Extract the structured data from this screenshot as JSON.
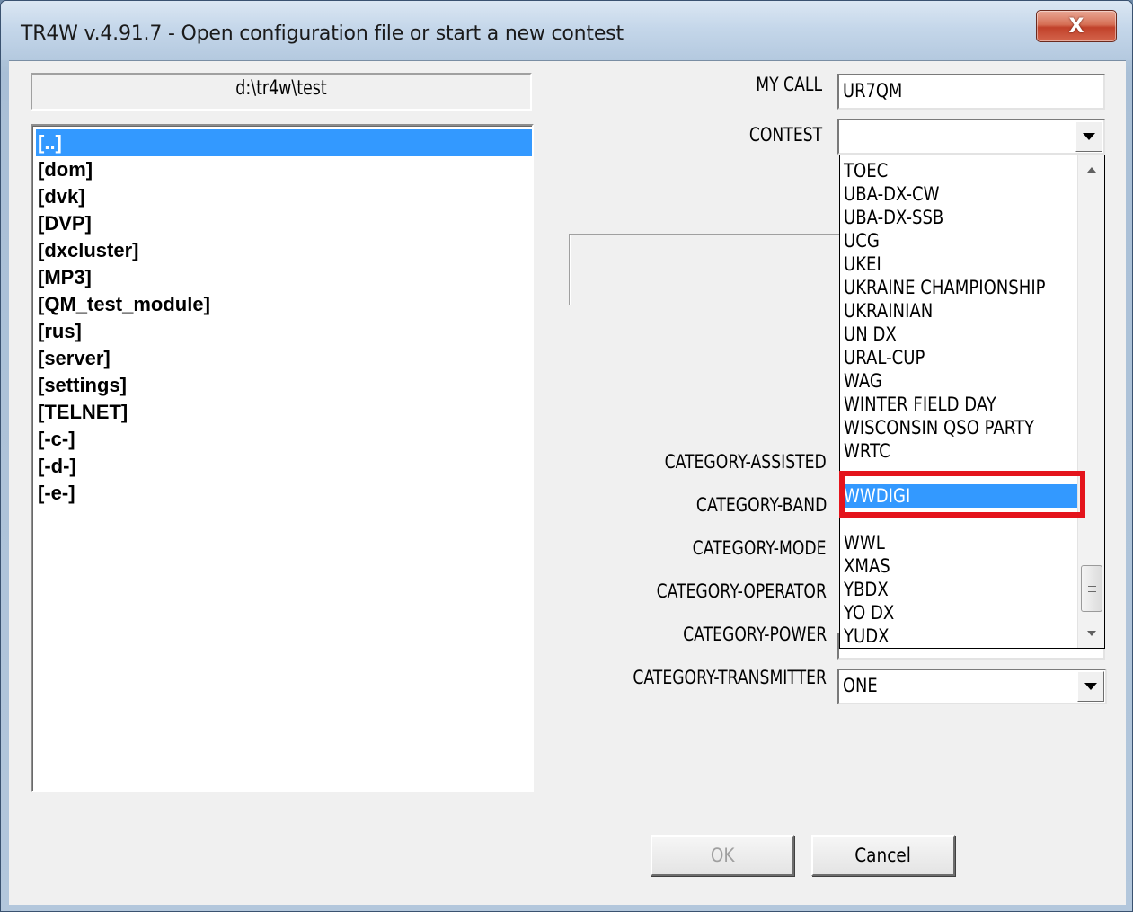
{
  "window": {
    "title": "TR4W v.4.91.7 - Open configuration file or start a new contest",
    "close_glyph": "X"
  },
  "directory": {
    "path": "d:\\tr4w\\test",
    "items": [
      "[..]",
      "[dom]",
      "[dvk]",
      "[DVP]",
      "[dxcluster]",
      "[MP3]",
      "[QM_test_module]",
      "[rus]",
      "[server]",
      "[settings]",
      "[TELNET]",
      "[-c-]",
      "[-d-]",
      "[-e-]"
    ],
    "selected_index": 0
  },
  "form": {
    "my_call_label": "MY CALL",
    "my_call_value": "UR7QM",
    "contest_label": "CONTEST",
    "contest_value": "",
    "category_assisted_label": "CATEGORY-ASSISTED",
    "category_band_label": "CATEGORY-BAND",
    "category_mode_label": "CATEGORY-MODE",
    "category_operator_label": "CATEGORY-OPERATOR",
    "category_power_label": "CATEGORY-POWER",
    "category_transmitter_label": "CATEGORY-TRANSMITTER",
    "category_transmitter_value": "ONE"
  },
  "contest_dropdown": {
    "items": [
      "TOEC",
      "UBA-DX-CW",
      "UBA-DX-SSB",
      "UCG",
      "UKEI",
      "UKRAINE CHAMPIONSHIP",
      "UKRAINIAN",
      "UN DX",
      "URAL-CUP",
      "WAG",
      "WINTER FIELD DAY",
      "WISCONSIN QSO PARTY",
      "WRTC",
      "WWDIGI",
      "WWL",
      "XMAS",
      "YBDX",
      "YO DX",
      "YUDX"
    ],
    "selected": "WWDIGI",
    "highlight_color": "#e4141c",
    "selection_color": "#3399ff"
  },
  "buttons": {
    "ok_label": "OK",
    "cancel_label": "Cancel"
  }
}
